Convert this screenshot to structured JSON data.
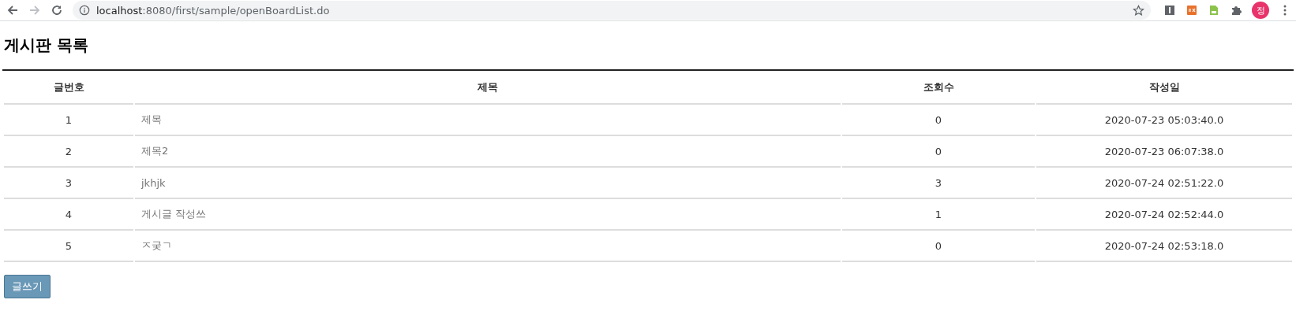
{
  "browser": {
    "url_host": "localhost",
    "url_rest": ":8080/first/sample/openBoardList.do",
    "profile_initial": "정"
  },
  "page_title": "게시판 목록",
  "table": {
    "columns": [
      "글번호",
      "제목",
      "조회수",
      "작성일"
    ],
    "rows": [
      {
        "number": "1",
        "title": "제목",
        "views": "0",
        "created": "2020-07-23 05:03:40.0"
      },
      {
        "number": "2",
        "title": "제목2",
        "views": "0",
        "created": "2020-07-23 06:07:38.0"
      },
      {
        "number": "3",
        "title": "jkhjk",
        "views": "3",
        "created": "2020-07-24 02:51:22.0"
      },
      {
        "number": "4",
        "title": "게시글 작성쓰",
        "views": "1",
        "created": "2020-07-24 02:52:44.0"
      },
      {
        "number": "5",
        "title": "ㅈ궂ㄱ",
        "views": "0",
        "created": "2020-07-24 02:53:18.0"
      }
    ]
  },
  "write_button": "글쓰기"
}
